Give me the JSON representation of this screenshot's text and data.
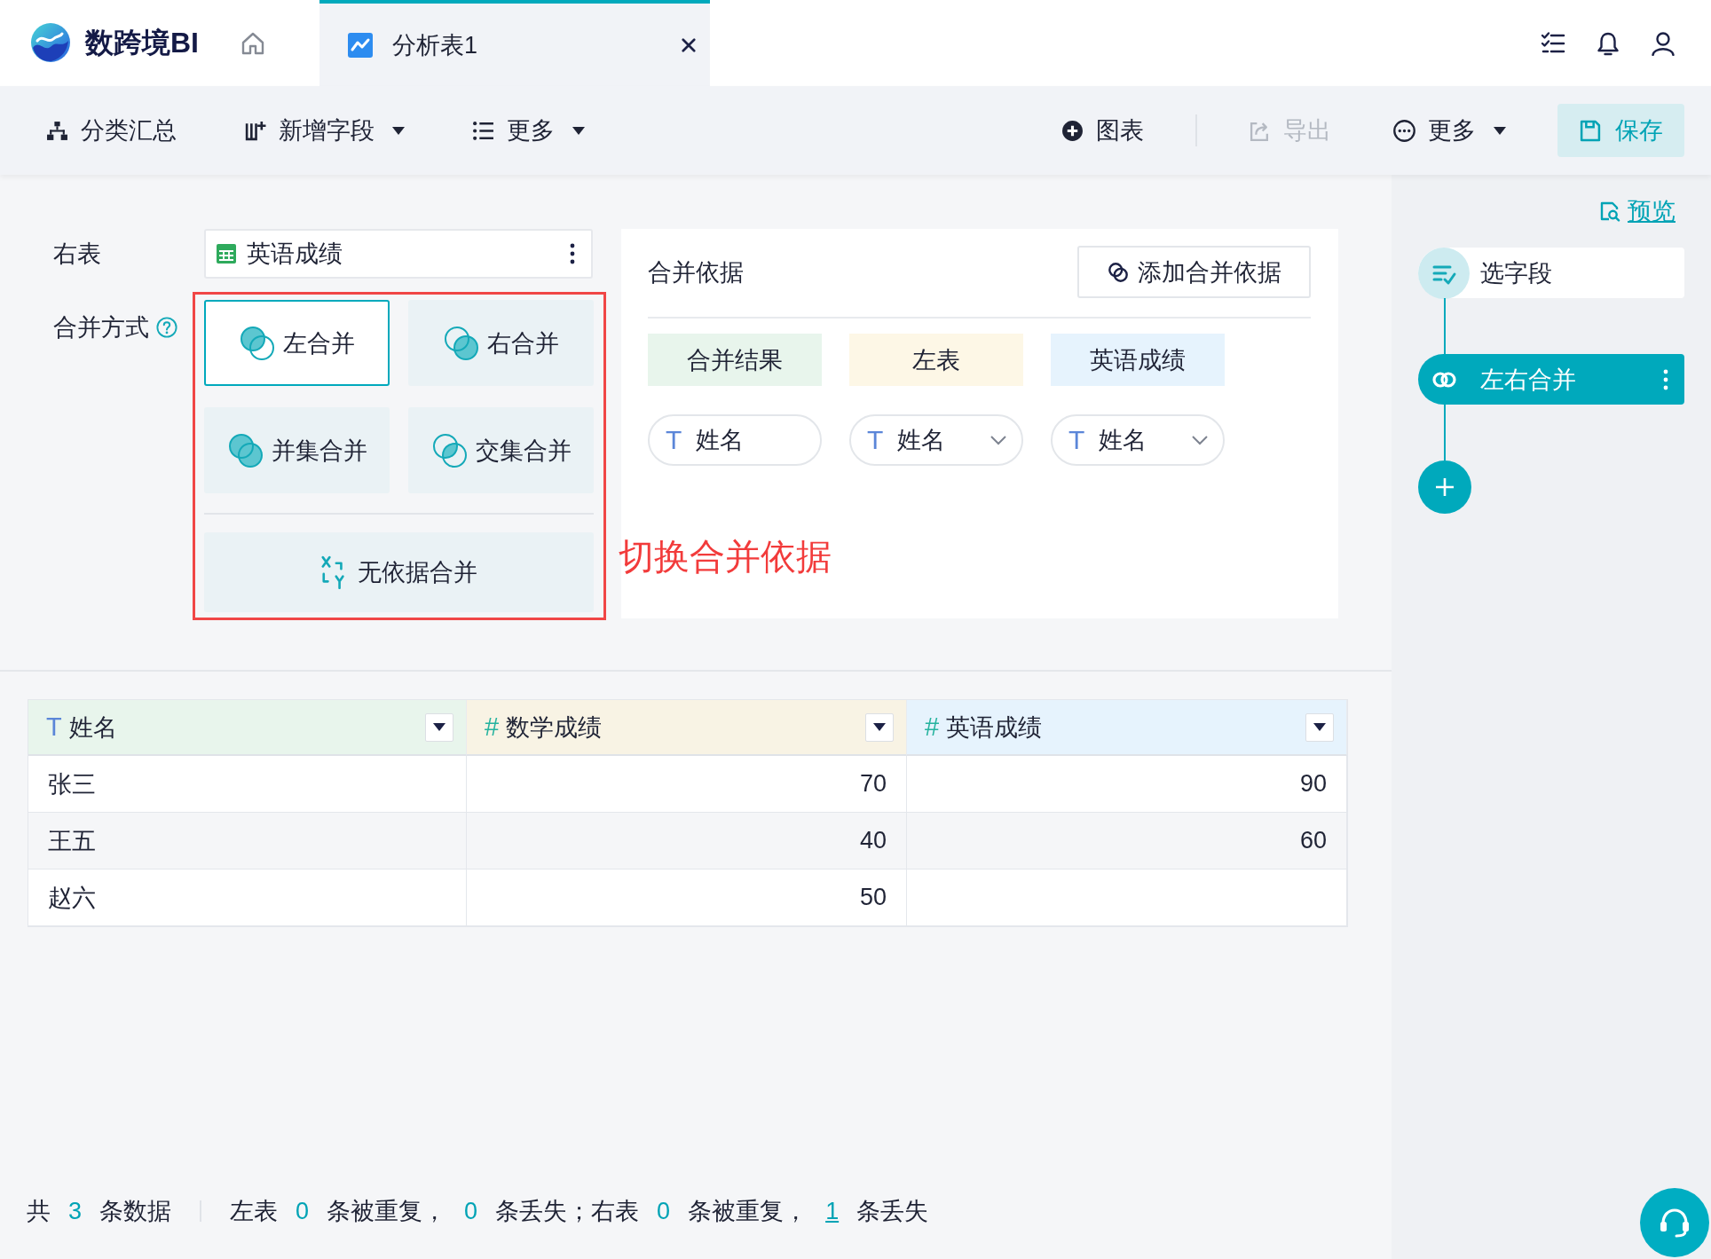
{
  "header": {
    "logo_text": "数跨境BI",
    "tabs": [
      {
        "label": "分析表1",
        "selected": true
      }
    ]
  },
  "toolbar": {
    "left": [
      {
        "label": "分类汇总",
        "dropdown": false,
        "disabled": false
      },
      {
        "label": "新增字段",
        "dropdown": true,
        "disabled": false
      },
      {
        "label": "更多",
        "dropdown": true,
        "disabled": false
      }
    ],
    "right": [
      {
        "label": "图表",
        "dropdown": false,
        "disabled": false
      },
      {
        "label": "导出",
        "dropdown": false,
        "disabled": true
      },
      {
        "label": "更多",
        "dropdown": true,
        "disabled": false
      }
    ],
    "save_button": {
      "label": "保存"
    }
  },
  "right_table": {
    "label": "右表",
    "value": "英语成绩"
  },
  "merge_mode": {
    "label": "合并方式",
    "options": [
      {
        "kind": "left",
        "label": "左合并",
        "selected": true
      },
      {
        "kind": "right",
        "label": "右合并",
        "selected": false
      },
      {
        "kind": "union",
        "label": "并集合并",
        "selected": false
      },
      {
        "kind": "inner",
        "label": "交集合并",
        "selected": false
      },
      {
        "kind": "none",
        "label": "无依据合并",
        "selected": false
      }
    ]
  },
  "annotation": {
    "text": "切换合并依据"
  },
  "merge_basis": {
    "title": "合并依据",
    "add_button": "添加合并依据",
    "columns": [
      {
        "label": "合并结果",
        "color": "#e8f5ec",
        "field": {
          "symbol": "T",
          "name": "姓名",
          "dropdown": false
        }
      },
      {
        "label": "左表",
        "color": "#fdf7e6",
        "field": {
          "symbol": "T",
          "name": "姓名",
          "dropdown": true
        }
      },
      {
        "label": "英语成绩",
        "color": "#e6f3fd",
        "field": {
          "symbol": "T",
          "name": "姓名",
          "dropdown": true
        }
      }
    ]
  },
  "sidebar": {
    "preview_link": "预览",
    "steps": [
      {
        "kind": "select",
        "label": "选字段",
        "selected": false
      },
      {
        "kind": "merge",
        "label": "左右合并",
        "selected": true
      }
    ]
  },
  "table": {
    "columns": [
      {
        "symbol": "T",
        "kind": "text",
        "label": "姓名",
        "color": "#e8f5ec"
      },
      {
        "symbol": "#",
        "kind": "number",
        "label": "数学成绩",
        "color": "#f8f3e4"
      },
      {
        "symbol": "#",
        "kind": "number",
        "label": "英语成绩",
        "color": "#e6f3fd"
      }
    ],
    "rows": [
      [
        "张三",
        "70",
        "90"
      ],
      [
        "王五",
        "40",
        "60"
      ],
      [
        "赵六",
        "50",
        null
      ]
    ]
  },
  "status_bar": {
    "groups": [
      [
        {
          "kind": "text",
          "text": "共"
        },
        {
          "kind": "number",
          "text": "3"
        },
        {
          "kind": "text",
          "text": "条数据"
        }
      ],
      [
        {
          "kind": "text",
          "text": "左表"
        },
        {
          "kind": "number",
          "text": "0"
        },
        {
          "kind": "text",
          "text": "条被重复，"
        },
        {
          "kind": "number",
          "text": "0"
        },
        {
          "kind": "text",
          "text": "条丢失；右表"
        },
        {
          "kind": "number",
          "text": "0"
        },
        {
          "kind": "text",
          "text": "条被重复，"
        },
        {
          "kind": "link",
          "text": "1"
        },
        {
          "kind": "text",
          "text": "条丢失"
        }
      ]
    ]
  }
}
